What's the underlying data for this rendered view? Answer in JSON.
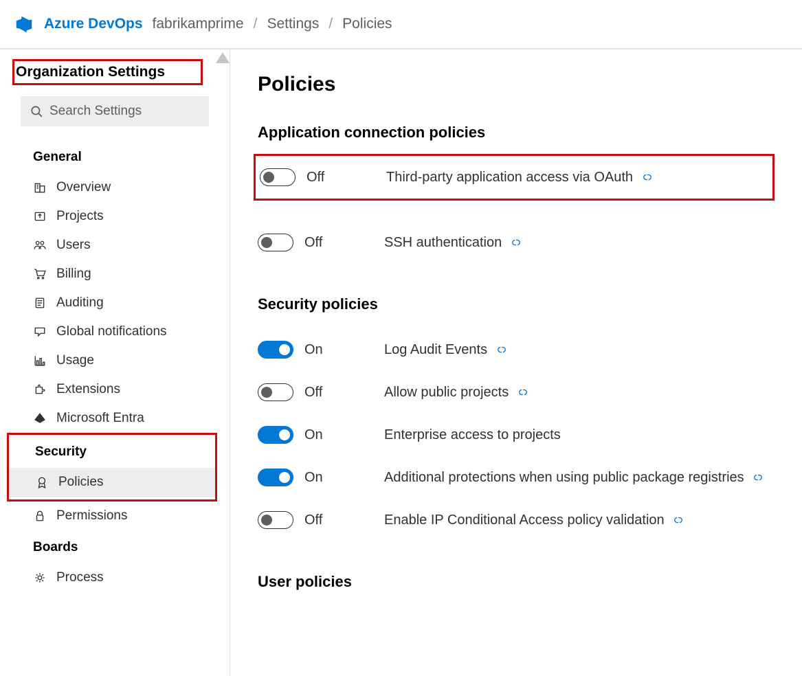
{
  "header": {
    "product": "Azure DevOps",
    "crumbs": [
      "fabrikamprime",
      "Settings",
      "Policies"
    ]
  },
  "sidebar": {
    "title": "Organization Settings",
    "search_placeholder": "Search Settings",
    "sections": [
      {
        "name": "General",
        "items": [
          {
            "icon": "building-icon",
            "label": "Overview"
          },
          {
            "icon": "upload-icon",
            "label": "Projects"
          },
          {
            "icon": "users-icon",
            "label": "Users"
          },
          {
            "icon": "cart-icon",
            "label": "Billing"
          },
          {
            "icon": "notes-icon",
            "label": "Auditing"
          },
          {
            "icon": "chat-icon",
            "label": "Global notifications"
          },
          {
            "icon": "chart-icon",
            "label": "Usage"
          },
          {
            "icon": "puzzle-icon",
            "label": "Extensions"
          },
          {
            "icon": "entra-icon",
            "label": "Microsoft Entra"
          }
        ]
      },
      {
        "name": "Security",
        "items": [
          {
            "icon": "badge-icon",
            "label": "Policies",
            "active": true
          },
          {
            "icon": "lock-icon",
            "label": "Permissions"
          }
        ]
      },
      {
        "name": "Boards",
        "items": [
          {
            "icon": "gear-icon",
            "label": "Process"
          }
        ]
      }
    ]
  },
  "main": {
    "title": "Policies",
    "sections": [
      {
        "title": "Application connection policies",
        "policies": [
          {
            "on": false,
            "state": "Off",
            "label": "Third-party application access via OAuth",
            "link": true,
            "highlighted": true
          },
          {
            "on": false,
            "state": "Off",
            "label": "SSH authentication",
            "link": true
          }
        ]
      },
      {
        "title": "Security policies",
        "policies": [
          {
            "on": true,
            "state": "On",
            "label": "Log Audit Events",
            "link": true
          },
          {
            "on": false,
            "state": "Off",
            "label": "Allow public projects",
            "link": true
          },
          {
            "on": true,
            "state": "On",
            "label": "Enterprise access to projects",
            "link": false
          },
          {
            "on": true,
            "state": "On",
            "label": "Additional protections when using public package registries",
            "link": true
          },
          {
            "on": false,
            "state": "Off",
            "label": "Enable IP Conditional Access policy validation",
            "link": true
          }
        ]
      },
      {
        "title": "User policies",
        "policies": []
      }
    ]
  }
}
